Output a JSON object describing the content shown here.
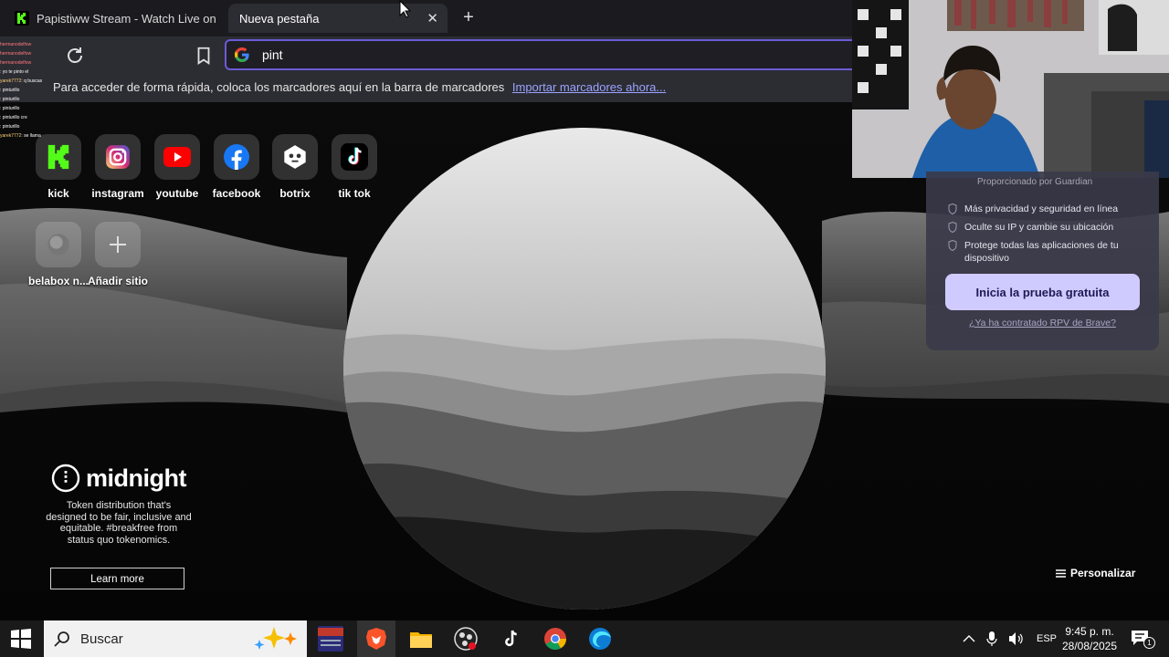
{
  "tabs": [
    {
      "title": "Papistiww Stream - Watch Live on Kick"
    },
    {
      "title": "Nueva pestaña"
    }
  ],
  "urlbar": {
    "value": "pint"
  },
  "bookmarks_bar": {
    "message": "Para acceder de forma rápida, coloca los marcadores aquí en la barra de marcadores",
    "import_link": "Importar marcadores ahora..."
  },
  "chat": [
    {
      "user": "hermanodelfow",
      "msg": ""
    },
    {
      "user": "hermanodelfow",
      "msg": ""
    },
    {
      "user": "hermanodelfow",
      "msg": ""
    },
    {
      "user": "",
      "msg": ": yo te pinto el"
    },
    {
      "user": "yarek7772",
      "msg": ": q buscas"
    },
    {
      "user": "",
      "msg": ": pinturillo"
    },
    {
      "user": "",
      "msg": ": pinturillo"
    },
    {
      "user": "",
      "msg": ": pinturillo"
    },
    {
      "user": "",
      "msg": ": pinturillo cre"
    },
    {
      "user": "",
      "msg": ": pinturillo"
    },
    {
      "user": "yarek7772",
      "msg": ": se llama"
    }
  ],
  "top_sites": [
    {
      "label": "kick",
      "icon": "kick-logo-icon"
    },
    {
      "label": "instagram",
      "icon": "instagram-logo-icon"
    },
    {
      "label": "youtube",
      "icon": "youtube-logo-icon"
    },
    {
      "label": "facebook",
      "icon": "facebook-logo-icon"
    },
    {
      "label": "botrix",
      "icon": "botrix-logo-icon"
    },
    {
      "label": "tik tok",
      "icon": "tiktok-logo-icon"
    },
    {
      "label": "belabox n...",
      "icon": "globe-icon"
    },
    {
      "label": "Añadir sitio",
      "icon": "plus-icon"
    }
  ],
  "vpn_card": {
    "provider": "Proporcionado por  Guardian",
    "features": [
      "Más privacidad y seguridad en línea",
      "Oculte su IP y cambie su ubicación",
      "Protege todas las aplicaciones de tu dispositivo"
    ],
    "cta": "Inicia la prueba gratuita",
    "already": "¿Ya ha contratado RPV de Brave?"
  },
  "sponsored": {
    "brand": "midnight",
    "tagline": "Token distribution that's designed to be fair, inclusive and equitable. #breakfree from status quo tokenomics.",
    "learn_more": "Learn more"
  },
  "customize": {
    "label": "Personalizar"
  },
  "taskbar": {
    "search_placeholder": "Buscar",
    "language": "ESP",
    "time": "9:45 p. m.",
    "date": "28/08/2025",
    "notifications": "1"
  },
  "colors": {
    "accent": "#6b5bd6",
    "kick_green": "#53fc18",
    "cta_bg": "#cfcbff"
  }
}
